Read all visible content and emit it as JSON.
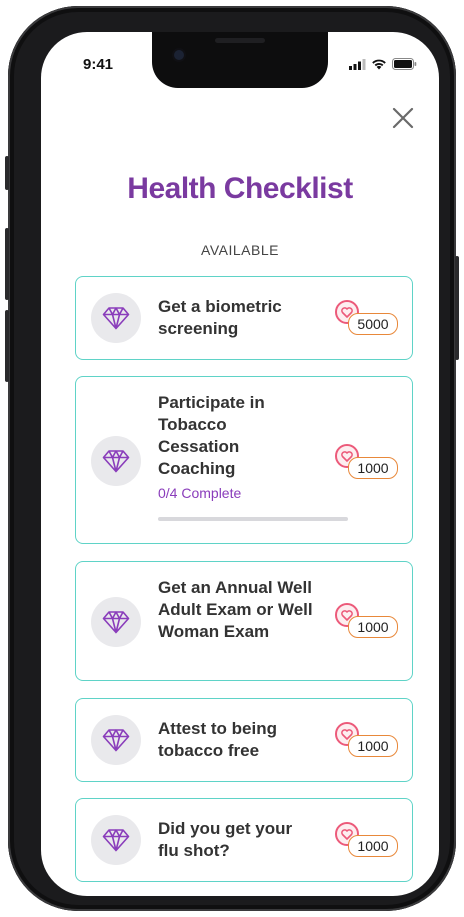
{
  "status_bar": {
    "time": "9:41"
  },
  "header": {
    "title": "Health Checklist",
    "section_label": "AVAILABLE"
  },
  "colors": {
    "title": "#7a3aa0",
    "card_border": "#5fd3c7",
    "reward_border": "#e8883a",
    "progress_text": "#8a3dbb"
  },
  "icons": {
    "close": "close-icon",
    "item": "diamond-icon",
    "reward": "heart-badge-icon"
  },
  "items": [
    {
      "title": "Get a biometric screening",
      "points": "5000"
    },
    {
      "title": "Participate in Tobacco Cessation Coaching",
      "progress": "0/4 Complete",
      "progress_fraction": 0,
      "points": "1000"
    },
    {
      "title": "Get an Annual Well Adult Exam or Well Woman Exam",
      "points": "1000"
    },
    {
      "title": "Attest to being tobacco free",
      "points": "1000"
    },
    {
      "title": "Did you get your flu shot?",
      "points": "1000"
    }
  ]
}
